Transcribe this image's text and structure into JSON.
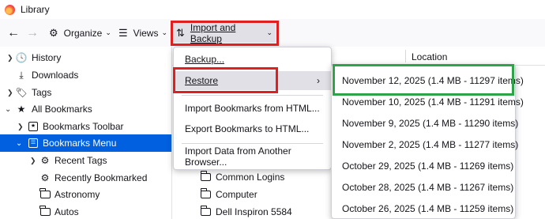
{
  "window": {
    "title": "Library"
  },
  "toolbar": {
    "back_icon": "arrow-left-icon",
    "forward_icon": "arrow-right-icon",
    "organize_label": "Organize",
    "views_label": "Views",
    "import_label": "Import and Backup"
  },
  "tree": {
    "items": [
      {
        "label": "History"
      },
      {
        "label": "Downloads"
      },
      {
        "label": "Tags"
      },
      {
        "label": "All Bookmarks"
      },
      {
        "label": "Bookmarks Toolbar"
      },
      {
        "label": "Bookmarks Menu"
      },
      {
        "label": "Recent Tags"
      },
      {
        "label": "Recently Bookmarked"
      },
      {
        "label": "Astronomy"
      },
      {
        "label": "Autos"
      }
    ]
  },
  "content": {
    "column_location": "Location",
    "rows": [
      {
        "label": "Common Logins"
      },
      {
        "label": "Computer"
      },
      {
        "label": "Dell Inspiron 5584"
      }
    ]
  },
  "menu": {
    "items": [
      {
        "label": "Backup..."
      },
      {
        "label": "Restore"
      },
      {
        "label": "Import Bookmarks from HTML..."
      },
      {
        "label": "Export Bookmarks to HTML..."
      },
      {
        "label": "Import Data from Another Browser..."
      }
    ]
  },
  "submenu": {
    "items": [
      {
        "label": "November 12, 2025 (1.4 MB - 11297 items)"
      },
      {
        "label": "November 10, 2025 (1.4 MB - 11291 items)"
      },
      {
        "label": "November 9, 2025 (1.4 MB - 11290 items)"
      },
      {
        "label": "November 2, 2025 (1.4 MB - 11277 items)"
      },
      {
        "label": "October 29, 2025 (1.4 MB - 11269 items)"
      },
      {
        "label": "October 28, 2025 (1.4 MB - 11267 items)"
      },
      {
        "label": "October 26, 2025 (1.4 MB - 11259 items)"
      }
    ]
  },
  "colors": {
    "selection": "#0060df",
    "highlight_red": "#e02020",
    "highlight_green": "#2ea34a"
  }
}
